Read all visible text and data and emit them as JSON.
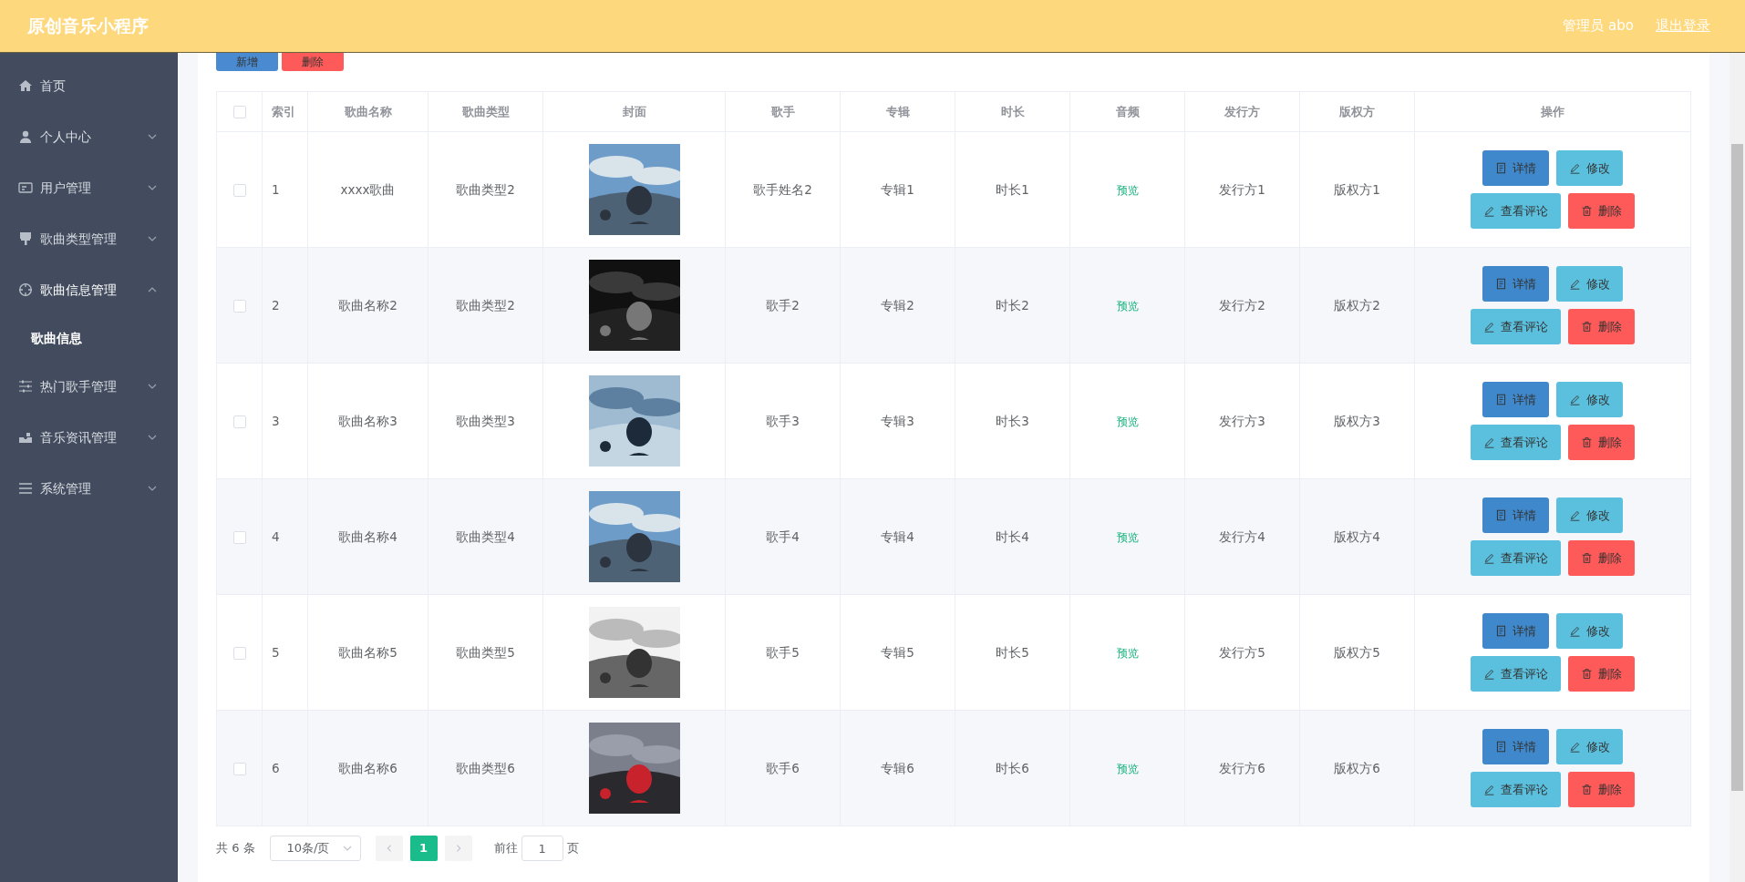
{
  "header": {
    "title": "原创音乐小程序",
    "user": "管理员 abo",
    "logout": "退出登录"
  },
  "sidebar": {
    "items": [
      {
        "label": "首页",
        "kind": "link"
      },
      {
        "label": "个人中心",
        "kind": "menu",
        "expanded": false
      },
      {
        "label": "用户管理",
        "kind": "menu",
        "expanded": false
      },
      {
        "label": "歌曲类型管理",
        "kind": "menu",
        "expanded": false
      },
      {
        "label": "歌曲信息管理",
        "kind": "menu",
        "expanded": true,
        "children": [
          {
            "label": "歌曲信息"
          }
        ]
      },
      {
        "label": "热门歌手管理",
        "kind": "menu",
        "expanded": false
      },
      {
        "label": "音乐资讯管理",
        "kind": "menu",
        "expanded": false
      },
      {
        "label": "系统管理",
        "kind": "menu",
        "expanded": false
      }
    ]
  },
  "toolbar": [
    {
      "label": "新增",
      "kind": "add"
    },
    {
      "label": "删除",
      "kind": "delete"
    }
  ],
  "table": {
    "select_all_checked": false,
    "columns": [
      "索引",
      "歌曲名称",
      "歌曲类型",
      "封面",
      "歌手",
      "专辑",
      "时长",
      "音频",
      "发行方",
      "版权方",
      "操作"
    ],
    "rows": [
      {
        "checked": false,
        "index": "1",
        "name": "xxxx歌曲",
        "type": "歌曲类型2",
        "singer": "歌手姓名2",
        "album": "专辑1",
        "duration": "时长1",
        "audio": "预览",
        "publisher": "发行方1",
        "copyright": "版权方1",
        "actions": [
          {
            "label": "详情",
            "kind": "detail"
          },
          {
            "label": "修改",
            "kind": "edit"
          },
          {
            "label": "查看评论",
            "kind": "comments"
          },
          {
            "label": "删除",
            "kind": "delete"
          }
        ]
      },
      {
        "checked": false,
        "index": "2",
        "name": "歌曲名称2",
        "type": "歌曲类型2",
        "singer": "歌手2",
        "album": "专辑2",
        "duration": "时长2",
        "audio": "预览",
        "publisher": "发行方2",
        "copyright": "版权方2",
        "actions": [
          {
            "label": "详情",
            "kind": "detail"
          },
          {
            "label": "修改",
            "kind": "edit"
          },
          {
            "label": "查看评论",
            "kind": "comments"
          },
          {
            "label": "删除",
            "kind": "delete"
          }
        ]
      },
      {
        "checked": false,
        "index": "3",
        "name": "歌曲名称3",
        "type": "歌曲类型3",
        "singer": "歌手3",
        "album": "专辑3",
        "duration": "时长3",
        "audio": "预览",
        "publisher": "发行方3",
        "copyright": "版权方3",
        "actions": [
          {
            "label": "详情",
            "kind": "detail"
          },
          {
            "label": "修改",
            "kind": "edit"
          },
          {
            "label": "查看评论",
            "kind": "comments"
          },
          {
            "label": "删除",
            "kind": "delete"
          }
        ]
      },
      {
        "checked": false,
        "index": "4",
        "name": "歌曲名称4",
        "type": "歌曲类型4",
        "singer": "歌手4",
        "album": "专辑4",
        "duration": "时长4",
        "audio": "预览",
        "publisher": "发行方4",
        "copyright": "版权方4",
        "actions": [
          {
            "label": "详情",
            "kind": "detail"
          },
          {
            "label": "修改",
            "kind": "edit"
          },
          {
            "label": "查看评论",
            "kind": "comments"
          },
          {
            "label": "删除",
            "kind": "delete"
          }
        ]
      },
      {
        "checked": false,
        "index": "5",
        "name": "歌曲名称5",
        "type": "歌曲类型5",
        "singer": "歌手5",
        "album": "专辑5",
        "duration": "时长5",
        "audio": "预览",
        "publisher": "发行方5",
        "copyright": "版权方5",
        "actions": [
          {
            "label": "详情",
            "kind": "detail"
          },
          {
            "label": "修改",
            "kind": "edit"
          },
          {
            "label": "查看评论",
            "kind": "comments"
          },
          {
            "label": "删除",
            "kind": "delete"
          }
        ]
      },
      {
        "checked": false,
        "index": "6",
        "name": "歌曲名称6",
        "type": "歌曲类型6",
        "singer": "歌手6",
        "album": "专辑6",
        "duration": "时长6",
        "audio": "预览",
        "publisher": "发行方6",
        "copyright": "版权方6",
        "actions": [
          {
            "label": "详情",
            "kind": "detail"
          },
          {
            "label": "修改",
            "kind": "edit"
          },
          {
            "label": "查看评论",
            "kind": "comments"
          },
          {
            "label": "删除",
            "kind": "delete"
          }
        ]
      }
    ]
  },
  "pagination": {
    "total": "共 6 条",
    "page_size": "10条/页",
    "pages": [
      {
        "label": "1",
        "selected": true
      }
    ],
    "goto_label": "前往",
    "goto_value": "1",
    "goto_suffix": "页"
  }
}
